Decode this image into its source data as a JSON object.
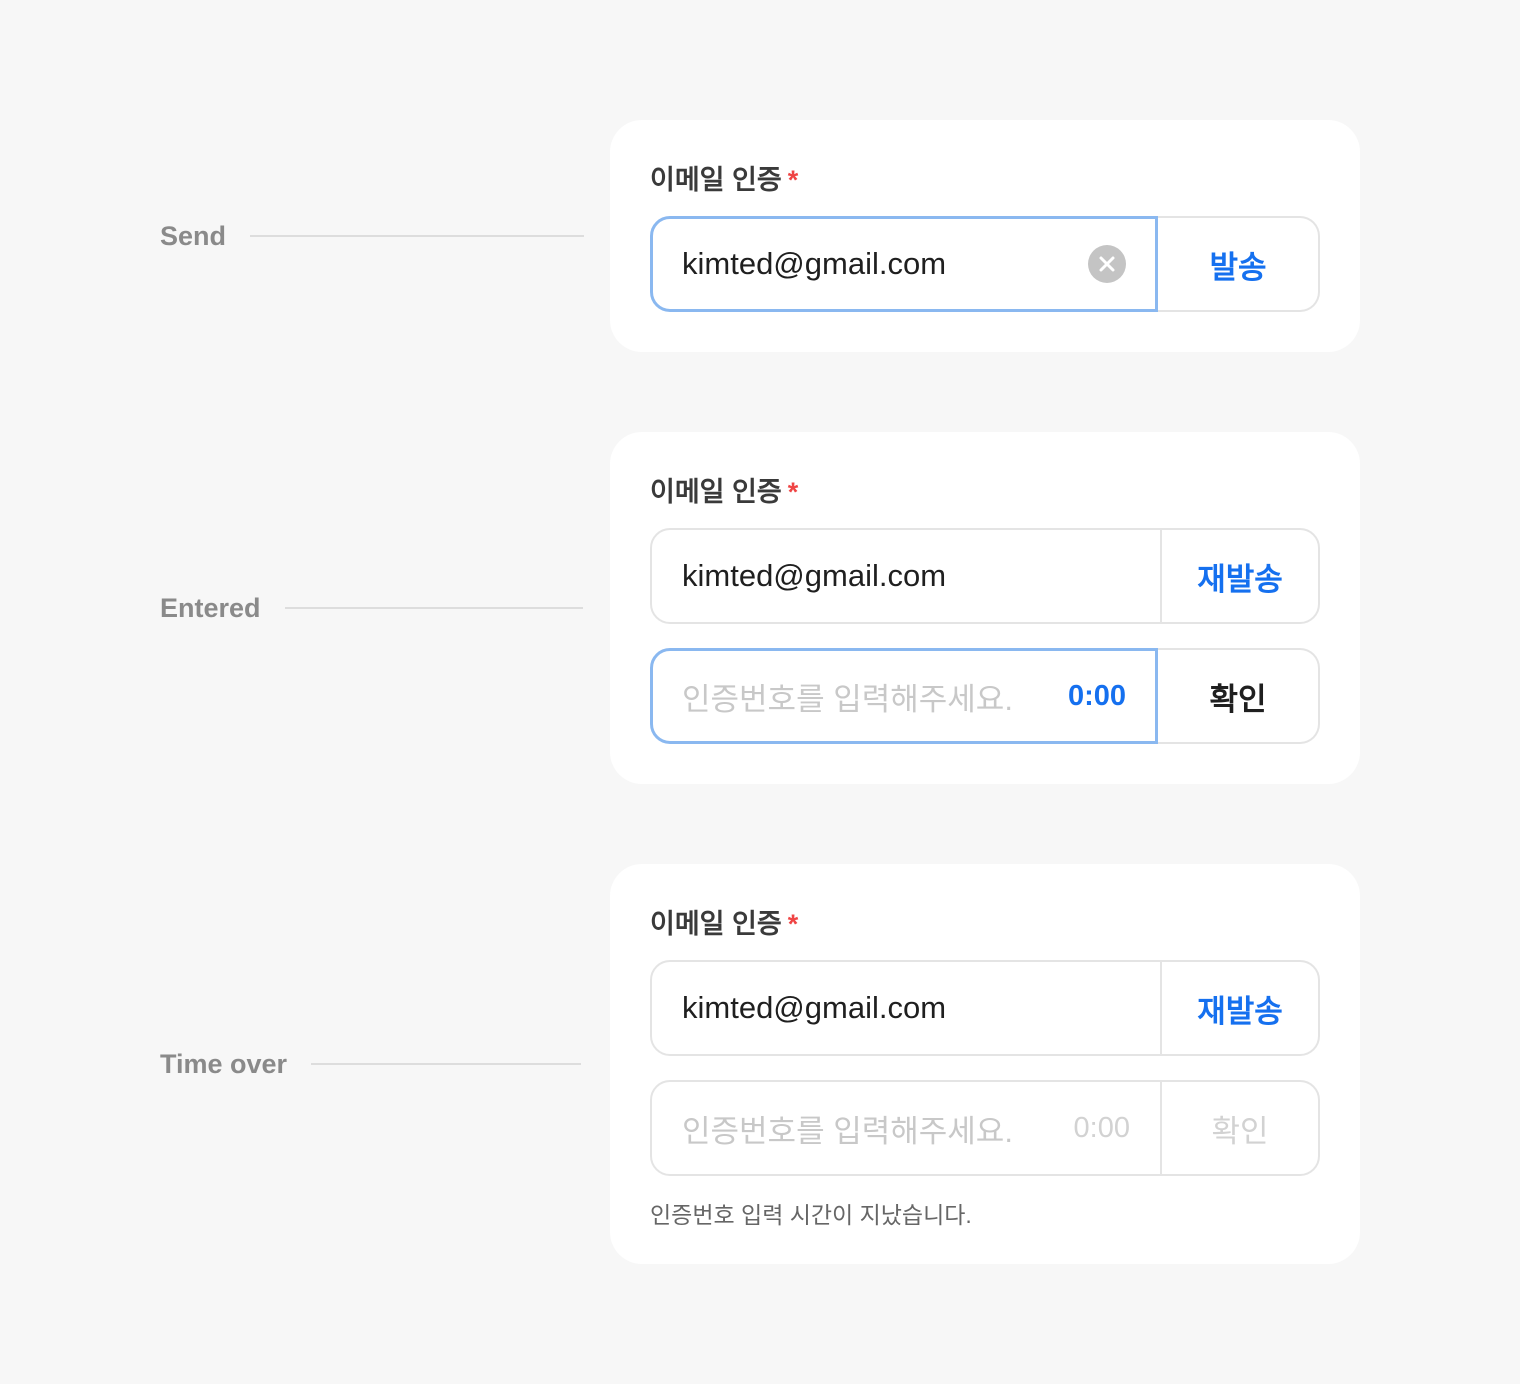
{
  "states": {
    "send": "Send",
    "entered": "Entered",
    "time_over": "Time over"
  },
  "field": {
    "label": "이메일 인증",
    "required_mark": "*"
  },
  "send_card": {
    "email_value": "kimted@gmail.com",
    "send_button": "발송"
  },
  "entered_card": {
    "email_value": "kimted@gmail.com",
    "resend_button": "재발송",
    "code_placeholder": "인증번호를 입력해주세요.",
    "timer": "0:00",
    "confirm_button": "확인"
  },
  "timeover_card": {
    "email_value": "kimted@gmail.com",
    "resend_button": "재발송",
    "code_placeholder": "인증번호를 입력해주세요.",
    "timer": "0:00",
    "confirm_button": "확인",
    "help_text": "인증번호 입력 시간이 지났습니다."
  },
  "colors": {
    "accent": "#1570ef",
    "focus_border": "#8ab8f0",
    "required": "#ef4444",
    "background": "#f7f7f7"
  },
  "icons": {
    "clear": "clear-circle-icon"
  }
}
